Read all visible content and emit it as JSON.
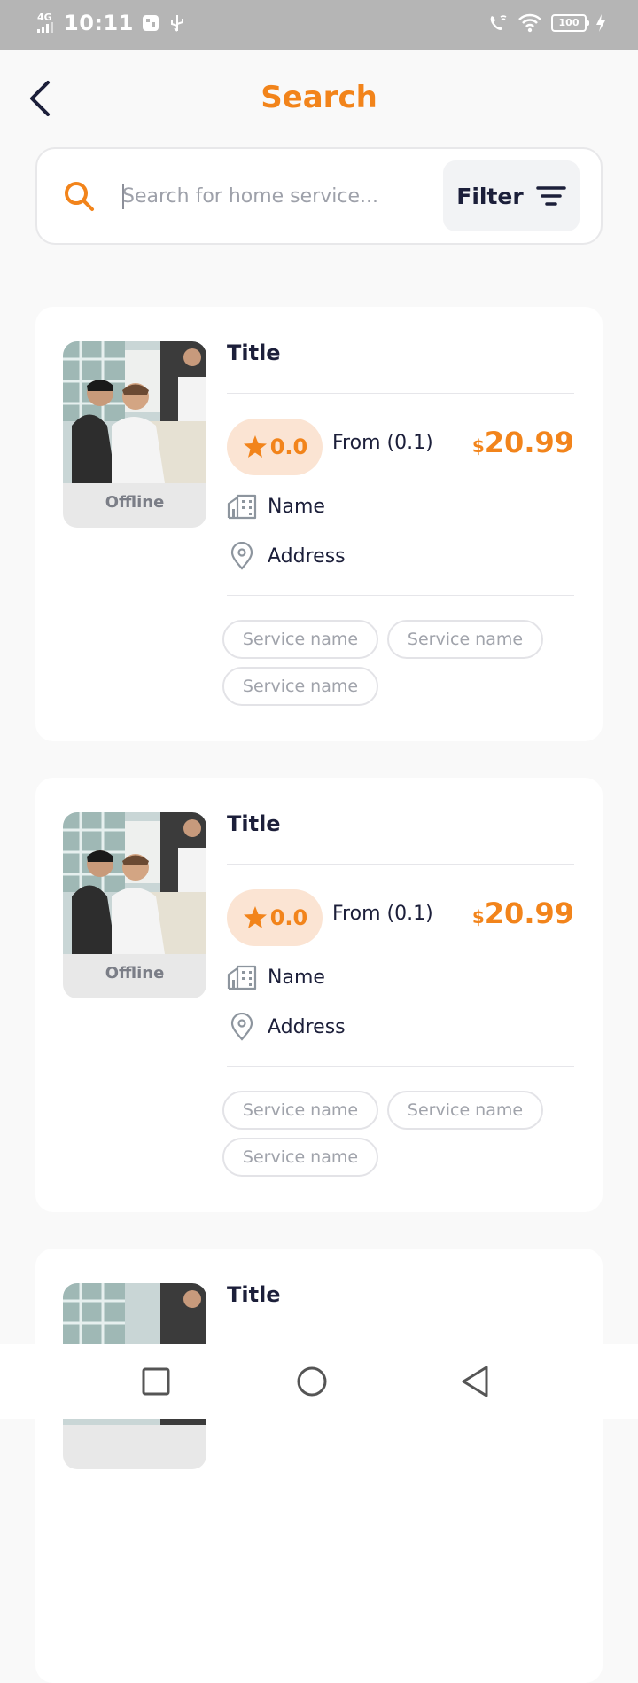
{
  "status_bar": {
    "network": "4G",
    "time": "10:11",
    "battery": "100"
  },
  "header": {
    "title": "Search"
  },
  "search": {
    "placeholder": "Search for home service...",
    "filter_label": "Filter"
  },
  "cards": [
    {
      "title": "Title",
      "status": "Offline",
      "rating": "0.0",
      "from_text": "From (0.1)",
      "currency": "$",
      "price": "20.99",
      "provider_name": "Name",
      "address": "Address",
      "services": [
        "Service name",
        "Service name",
        "Service name"
      ]
    },
    {
      "title": "Title",
      "status": "Offline",
      "rating": "0.0",
      "from_text": "From (0.1)",
      "currency": "$",
      "price": "20.99",
      "provider_name": "Name",
      "address": "Address",
      "services": [
        "Service name",
        "Service name",
        "Service name"
      ]
    },
    {
      "title": "Title"
    }
  ],
  "colors": {
    "accent": "#f2841b",
    "text_dark": "#1c1f3a",
    "pill_bg": "#fbe4d3",
    "status_bar": "#b5b5b5"
  },
  "icons": [
    "back-arrow-icon",
    "search-icon",
    "filter-icon",
    "star-icon",
    "building-icon",
    "location-pin-icon",
    "square-icon",
    "circle-icon",
    "triangle-back-icon"
  ]
}
